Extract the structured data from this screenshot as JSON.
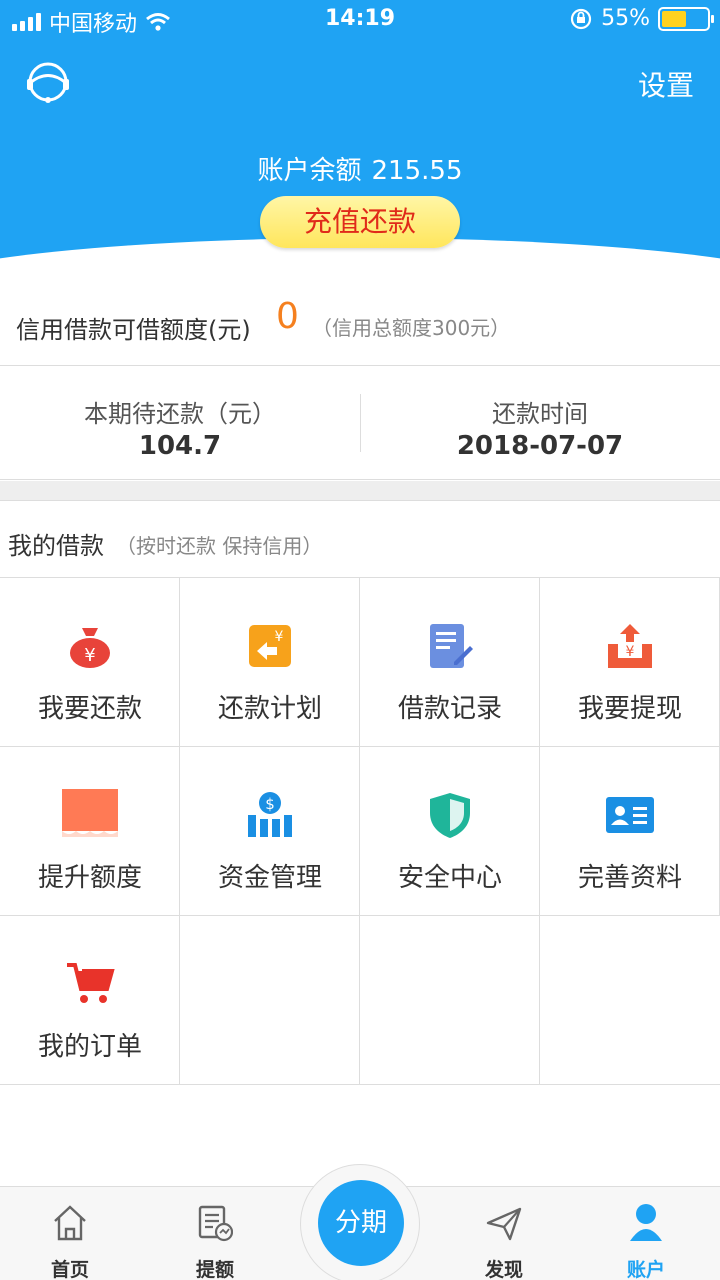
{
  "status_bar": {
    "carrier": "中国移动",
    "time": "14:19",
    "battery": "55%"
  },
  "nav": {
    "settings_label": "设置"
  },
  "account": {
    "balance_label": "账户余额",
    "balance_value": "215.55",
    "recharge_label": "充值还款"
  },
  "credit": {
    "label": "信用借款可借额度(元)",
    "value": "0",
    "total_note": "（信用总额度300元）"
  },
  "due": {
    "amount_label": "本期待还款（元）",
    "amount_value": "104.7",
    "date_label": "还款时间",
    "date_value": "2018-07-07"
  },
  "loans": {
    "title": "我的借款",
    "subtitle": "（按时还款 保持信用）",
    "items": [
      {
        "label": "我要还款",
        "icon": "money-bag-icon"
      },
      {
        "label": "还款计划",
        "icon": "repay-plan-icon"
      },
      {
        "label": "借款记录",
        "icon": "record-icon"
      },
      {
        "label": "我要提现",
        "icon": "withdraw-icon"
      },
      {
        "label": "提升额度",
        "icon": "raise-limit-icon"
      },
      {
        "label": "资金管理",
        "icon": "fund-management-icon"
      },
      {
        "label": "安全中心",
        "icon": "shield-icon"
      },
      {
        "label": "完善资料",
        "icon": "id-card-icon"
      },
      {
        "label": "我的订单",
        "icon": "cart-icon"
      }
    ]
  },
  "tabbar": {
    "items": [
      {
        "label": "首页",
        "icon": "home-icon"
      },
      {
        "label": "提额",
        "icon": "raise-icon"
      },
      {
        "label": "分期",
        "icon": "installment-button"
      },
      {
        "label": "发现",
        "icon": "paper-plane-icon"
      },
      {
        "label": "账户",
        "icon": "account-icon",
        "active": true
      }
    ]
  },
  "colors": {
    "primary": "#1fa3f3",
    "accent_orange": "#f5801f",
    "recharge_text": "#e02a1a"
  }
}
